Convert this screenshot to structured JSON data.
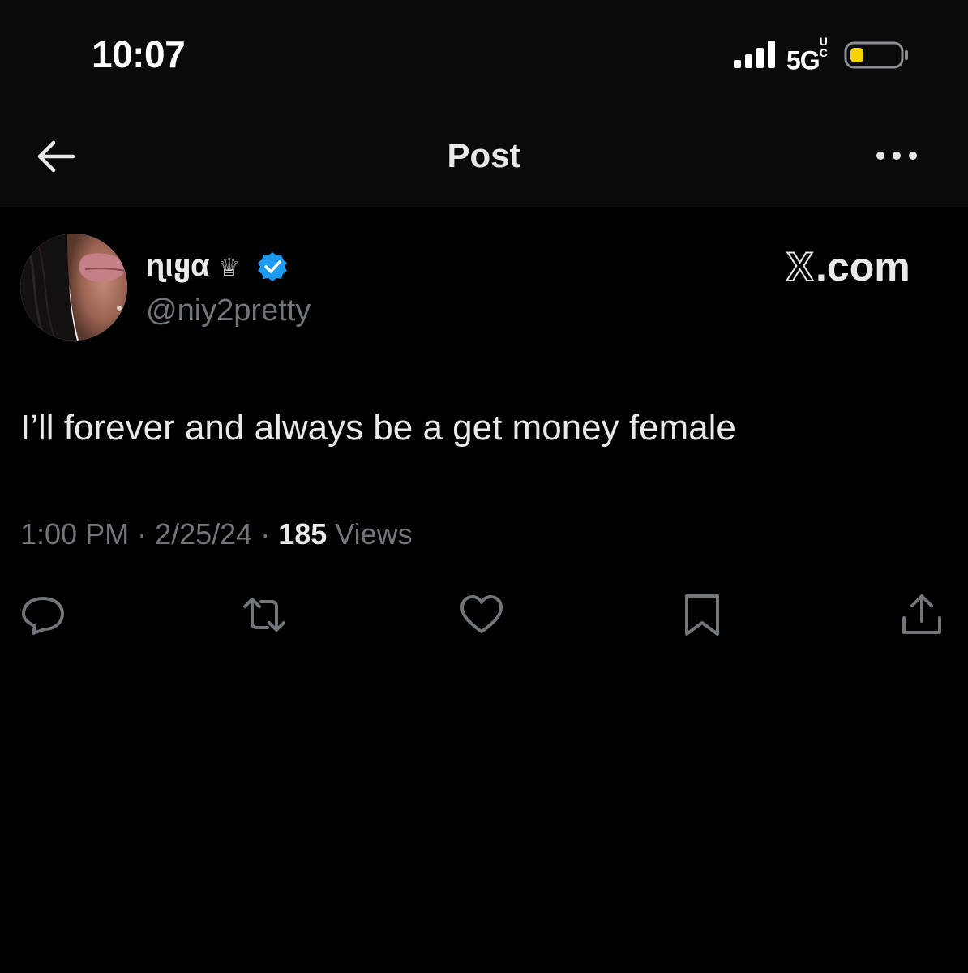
{
  "status_bar": {
    "time": "10:07",
    "network": "5G",
    "network_superscript": "UC",
    "signal_icon": "signal-bars-icon",
    "battery_icon": "battery-low-icon",
    "battery_color": "#f5d400"
  },
  "nav": {
    "title": "Post",
    "back_icon": "arrow-left-icon",
    "more_icon": "more-horizontal-icon"
  },
  "author": {
    "display_name": "ɳιყα",
    "crown": "♕",
    "handle": "@niy2pretty",
    "verified_icon": "verified-badge-icon",
    "verified_color": "#1d9bf0"
  },
  "watermark": {
    "x_letter": "X",
    "suffix": ".com"
  },
  "post": {
    "text": "I’ll forever and always be a get money female",
    "time": "1:00 PM",
    "separator": " · ",
    "date": "2/25/24",
    "views_count": "185",
    "views_label": " Views"
  },
  "actions": [
    {
      "name": "reply",
      "icon": "reply-icon"
    },
    {
      "name": "repost",
      "icon": "repost-icon"
    },
    {
      "name": "like",
      "icon": "heart-icon"
    },
    {
      "name": "bookmark",
      "icon": "bookmark-icon"
    },
    {
      "name": "share",
      "icon": "share-icon"
    }
  ],
  "colors": {
    "background": "#000000",
    "header_background": "#0a0a0a",
    "primary_text": "#e7e9ea",
    "secondary_text": "#71767b"
  }
}
